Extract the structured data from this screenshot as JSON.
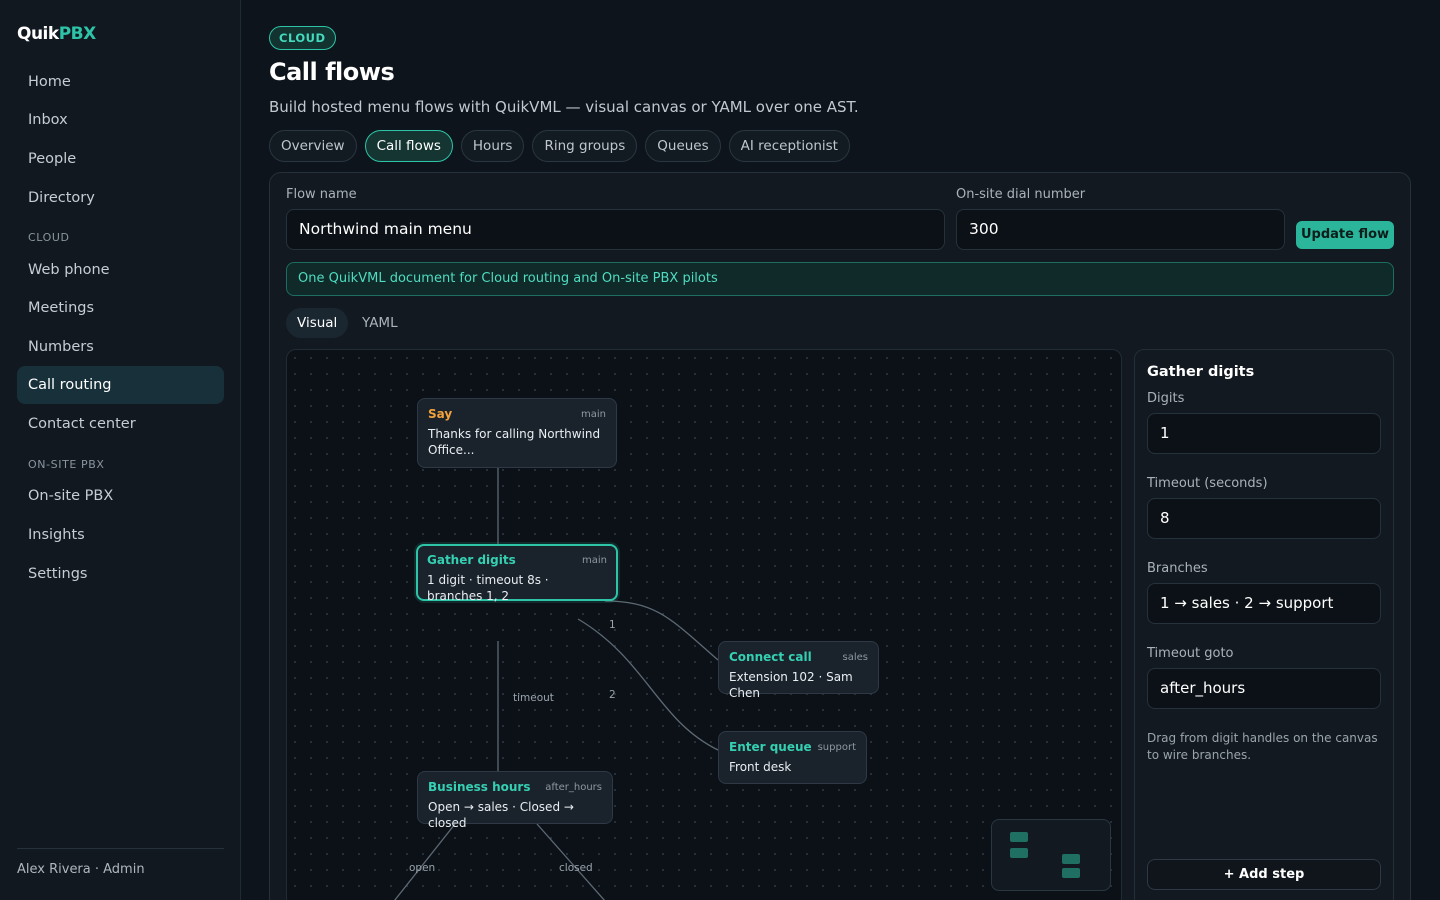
{
  "app": {
    "logo_part1": "Quik",
    "logo_part2": "PBX"
  },
  "sidebar": {
    "items": [
      {
        "label": "Home"
      },
      {
        "label": "Inbox"
      },
      {
        "label": "People"
      },
      {
        "label": "Directory"
      },
      {
        "label": "Web phone"
      },
      {
        "label": "Meetings"
      },
      {
        "label": "Numbers"
      },
      {
        "label": "Call routing",
        "active": true
      },
      {
        "label": "Contact center"
      },
      {
        "label": "On-site PBX"
      },
      {
        "label": "Insights"
      },
      {
        "label": "Settings"
      }
    ],
    "sections": {
      "cloud": "CLOUD",
      "onsite": "ON-SITE PBX"
    },
    "footer": "Alex Rivera · Admin"
  },
  "header": {
    "badge": "CLOUD",
    "title": "Call flows",
    "subtitle": "Build hosted menu flows with QuikVML — visual canvas or YAML over one AST."
  },
  "tabs": [
    {
      "label": "Overview"
    },
    {
      "label": "Call flows",
      "active": true
    },
    {
      "label": "Hours"
    },
    {
      "label": "Ring groups"
    },
    {
      "label": "Queues"
    },
    {
      "label": "AI receptionist"
    }
  ],
  "form": {
    "flow_name_label": "Flow name",
    "flow_name_value": "Northwind main menu",
    "dial_label": "On-site dial number",
    "dial_value": "300",
    "update_button": "Update flow",
    "info": "One QuikVML document for Cloud routing and On-site PBX pilots"
  },
  "editor_modes": {
    "visual": "Visual",
    "yaml": "YAML",
    "active": "visual"
  },
  "canvas": {
    "nodes": {
      "say": {
        "title": "Say",
        "tag": "main",
        "body": "Thanks for calling Northwind Office..."
      },
      "gather": {
        "title": "Gather digits",
        "tag": "main",
        "body": "1 digit · timeout 8s · branches 1, 2"
      },
      "connect": {
        "title": "Connect call",
        "tag": "sales",
        "body": "Extension 102 · Sam Chen"
      },
      "queue": {
        "title": "Enter queue",
        "tag": "support",
        "body": "Front desk"
      },
      "hours": {
        "title": "Business hours",
        "tag": "after_hours",
        "body": "Open → sales · Closed → closed"
      }
    },
    "edge_labels": {
      "one": "1",
      "two": "2",
      "timeout": "timeout",
      "open": "open",
      "closed": "closed"
    }
  },
  "inspector": {
    "title": "Gather digits",
    "digits_label": "Digits",
    "digits_value": "1",
    "timeout_label": "Timeout (seconds)",
    "timeout_value": "8",
    "branches_label": "Branches",
    "branches_value": "1 → sales · 2 → support",
    "timeout_goto_label": "Timeout goto",
    "timeout_goto_value": "after_hours",
    "hint": "Drag from digit handles on the canvas to wire branches.",
    "add_button": "+ Add step"
  },
  "colors": {
    "accent": "#2ec4a8",
    "background": "#0e141b",
    "say_accent": "#f2a33a"
  }
}
